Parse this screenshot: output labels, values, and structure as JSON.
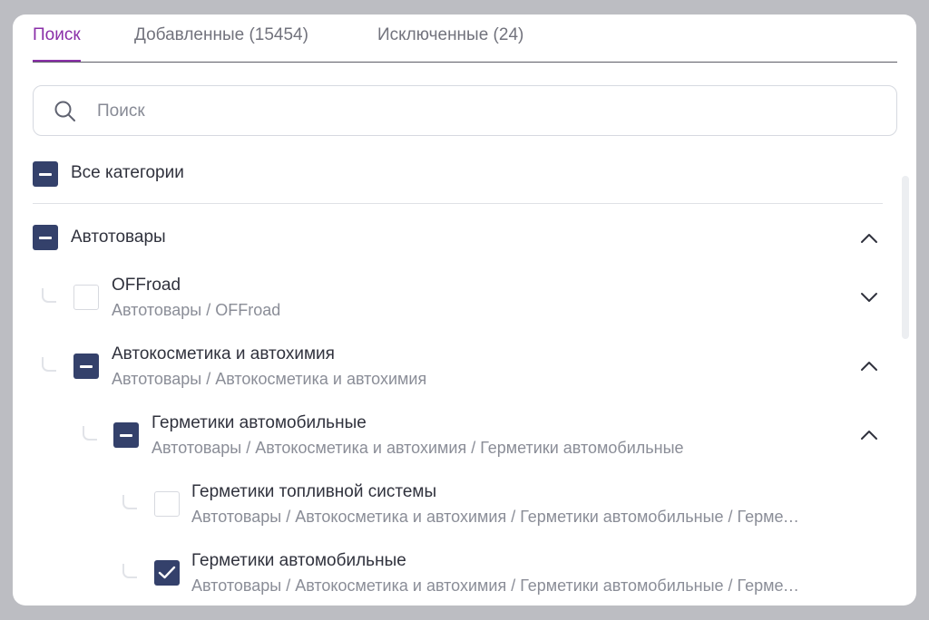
{
  "tabs": [
    {
      "label": "Поиск",
      "active": true
    },
    {
      "label": "Добавленные (15454)",
      "active": false
    },
    {
      "label": "Исключенные (24)",
      "active": false
    }
  ],
  "search": {
    "placeholder": "Поиск",
    "value": ""
  },
  "all_categories": {
    "label": "Все категории",
    "state": "partial"
  },
  "tree": [
    {
      "title": "Автотовары",
      "path": "",
      "state": "partial",
      "expanded": true
    },
    {
      "title": "OFFroad",
      "path": "Автотовары / OFFroad",
      "state": "unchecked",
      "expanded": false
    },
    {
      "title": "Автокосметика и автохимия",
      "path": "Автотовары / Автокосметика и автохимия",
      "state": "partial",
      "expanded": true
    },
    {
      "title": "Герметики автомобильные",
      "path": "Автотовары / Автокосметика и автохимия / Герметики автомобильные",
      "state": "partial",
      "expanded": true
    },
    {
      "title": "Герметики топливной системы",
      "path": "Автотовары / Автокосметика и автохимия / Герметики автомобильные / Герметики топливной системы",
      "state": "unchecked"
    },
    {
      "title": "Герметики автомобильные",
      "path": "Автотовары / Автокосметика и автохимия / Герметики автомобильные / Герметики автомобильные",
      "state": "checked"
    }
  ],
  "colors": {
    "accent": "#8a2fa8",
    "checkbox_fill": "#34416b",
    "text": "#30323d",
    "muted_text": "#8a8d97"
  }
}
